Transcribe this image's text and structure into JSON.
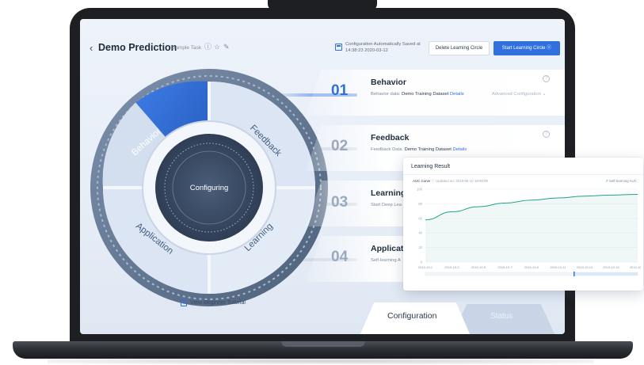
{
  "header": {
    "title": "Demo Prediction",
    "subtitle": "Sample Task",
    "save_line1": "Configuration Automatically Saved at",
    "save_line2": "14:38:23 2020-03-12",
    "delete_button": "Delete Learning Circle",
    "start_button": "Start Learning Circle"
  },
  "wheel": {
    "center_label": "Configuring",
    "segments": [
      "Behavior",
      "Feedback",
      "Learning",
      "Application"
    ],
    "active_segment": "Behavior"
  },
  "steps": [
    {
      "num": "01",
      "title": "Behavior",
      "desc_label": "Behavior data:",
      "desc_value": "Demo Training Dataset",
      "link": "Details",
      "extra": "Advanced Configuration"
    },
    {
      "num": "02",
      "title": "Feedback",
      "desc_label": "Feedback Data:",
      "desc_value": "Demo Training Dataset",
      "link": "Details"
    },
    {
      "num": "03",
      "title": "Learning",
      "desc_label": "Start Deep Lea"
    },
    {
      "num": "04",
      "title": "Applicat",
      "desc_label": "Self-learning A"
    }
  ],
  "tutorial_label": "View Beginner Tutorial",
  "tabs": {
    "configuration": "Configuration",
    "status": "Status"
  },
  "result_card": {
    "title": "Learning Result",
    "curve_label": "AUC Curve",
    "updated": "Updated on: 2019-02-10 18:00:00",
    "legend": "Self-learning AUC"
  },
  "colors": {
    "accent": "#2f6fde",
    "curve": "#23a28a"
  },
  "chart_data": {
    "type": "area",
    "title": "",
    "xlabel": "",
    "ylabel": "",
    "categories": [
      "2019-10-1",
      "2019-10-3",
      "2019-10-5",
      "2019-10-7",
      "2019-10-9",
      "2019-10-11",
      "2019-10-13",
      "2019-10-15",
      "2019-10-17"
    ],
    "ylim": [
      0,
      100
    ],
    "yticks": [
      0,
      20,
      40,
      60,
      80,
      100
    ],
    "series": [
      {
        "name": "Self-learning AUC",
        "values": [
          58,
          69,
          76,
          81,
          85,
          88,
          90.5,
          92,
          93
        ]
      }
    ]
  }
}
